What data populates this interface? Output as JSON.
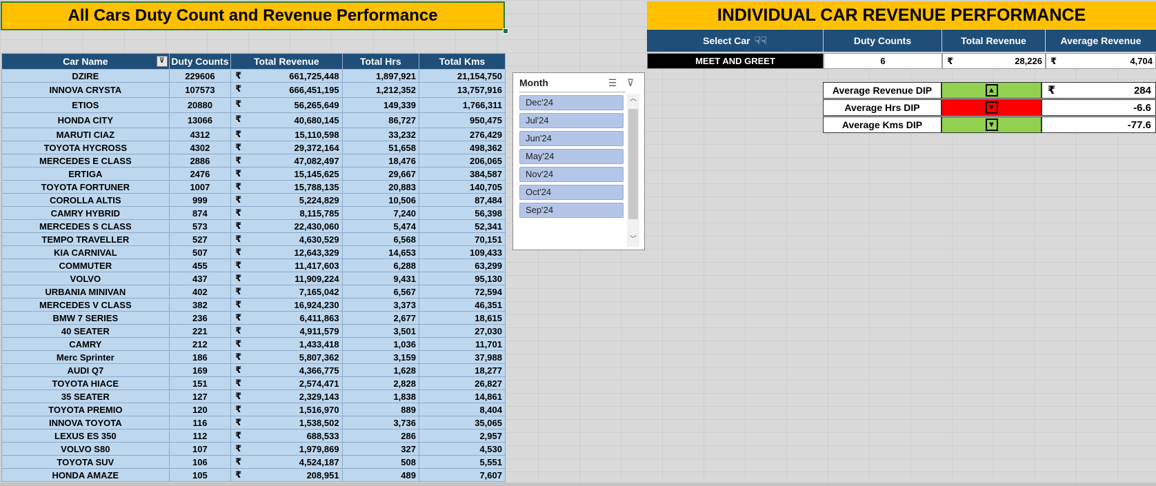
{
  "left_title": "All Cars Duty Count and Revenue Performance",
  "table": {
    "currency_symbol": "₹",
    "headers": [
      "Car Name",
      "Duty Counts",
      "Total Revenue",
      "Total Hrs",
      "Total Kms"
    ],
    "rows": [
      {
        "name": "DZIRE",
        "duty": "229606",
        "rev": "661,725,448",
        "hrs": "1,897,921",
        "kms": "21,154,750"
      },
      {
        "name": "INNOVA CRYSTA",
        "duty": "107573",
        "rev": "666,451,195",
        "hrs": "1,212,352",
        "kms": "13,757,916"
      },
      {
        "name": "ETIOS",
        "duty": "20880",
        "rev": "56,265,649",
        "hrs": "149,339",
        "kms": "1,766,311"
      },
      {
        "name": "HONDA CITY",
        "duty": "13066",
        "rev": "40,680,145",
        "hrs": "86,727",
        "kms": "950,475"
      },
      {
        "name": "MARUTI CIAZ",
        "duty": "4312",
        "rev": "15,110,598",
        "hrs": "33,232",
        "kms": "276,429"
      },
      {
        "name": "TOYOTA HYCROSS",
        "duty": "4302",
        "rev": "29,372,164",
        "hrs": "51,658",
        "kms": "498,362"
      },
      {
        "name": "MERCEDES E CLASS",
        "duty": "2886",
        "rev": "47,082,497",
        "hrs": "18,476",
        "kms": "206,065"
      },
      {
        "name": "ERTIGA",
        "duty": "2476",
        "rev": "15,145,625",
        "hrs": "29,667",
        "kms": "384,587"
      },
      {
        "name": "TOYOTA FORTUNER",
        "duty": "1007",
        "rev": "15,788,135",
        "hrs": "20,883",
        "kms": "140,705"
      },
      {
        "name": "COROLLA ALTIS",
        "duty": "999",
        "rev": "5,224,829",
        "hrs": "10,506",
        "kms": "87,484"
      },
      {
        "name": "CAMRY HYBRID",
        "duty": "874",
        "rev": "8,115,785",
        "hrs": "7,240",
        "kms": "56,398"
      },
      {
        "name": "MERCEDES S CLASS",
        "duty": "573",
        "rev": "22,430,060",
        "hrs": "5,474",
        "kms": "52,341"
      },
      {
        "name": "TEMPO TRAVELLER",
        "duty": "527",
        "rev": "4,630,529",
        "hrs": "6,568",
        "kms": "70,151"
      },
      {
        "name": "KIA CARNIVAL",
        "duty": "507",
        "rev": "12,643,329",
        "hrs": "14,653",
        "kms": "109,433"
      },
      {
        "name": "COMMUTER",
        "duty": "455",
        "rev": "11,417,603",
        "hrs": "6,288",
        "kms": "63,299"
      },
      {
        "name": "VOLVO",
        "duty": "437",
        "rev": "11,909,224",
        "hrs": "9,431",
        "kms": "95,130"
      },
      {
        "name": "URBANIA MINIVAN",
        "duty": "402",
        "rev": "7,165,042",
        "hrs": "6,567",
        "kms": "72,594"
      },
      {
        "name": "MERCEDES V CLASS",
        "duty": "382",
        "rev": "16,924,230",
        "hrs": "3,373",
        "kms": "46,351"
      },
      {
        "name": "BMW 7 SERIES",
        "duty": "236",
        "rev": "6,411,863",
        "hrs": "2,677",
        "kms": "18,615"
      },
      {
        "name": "40 SEATER",
        "duty": "221",
        "rev": "4,911,579",
        "hrs": "3,501",
        "kms": "27,030"
      },
      {
        "name": "CAMRY",
        "duty": "212",
        "rev": "1,433,418",
        "hrs": "1,036",
        "kms": "11,701"
      },
      {
        "name": "Merc Sprinter",
        "duty": "186",
        "rev": "5,807,362",
        "hrs": "3,159",
        "kms": "37,988"
      },
      {
        "name": "AUDI Q7",
        "duty": "169",
        "rev": "4,366,775",
        "hrs": "1,628",
        "kms": "18,277"
      },
      {
        "name": "TOYOTA HIACE",
        "duty": "151",
        "rev": "2,574,471",
        "hrs": "2,828",
        "kms": "26,827"
      },
      {
        "name": "35 SEATER",
        "duty": "127",
        "rev": "2,329,143",
        "hrs": "1,838",
        "kms": "14,861"
      },
      {
        "name": "TOYOTA PREMIO",
        "duty": "120",
        "rev": "1,516,970",
        "hrs": "889",
        "kms": "8,404"
      },
      {
        "name": "INNOVA TOYOTA",
        "duty": "116",
        "rev": "1,538,502",
        "hrs": "3,736",
        "kms": "35,065"
      },
      {
        "name": "LEXUS ES 350",
        "duty": "112",
        "rev": "688,533",
        "hrs": "286",
        "kms": "2,957"
      },
      {
        "name": "VOLVO S80",
        "duty": "107",
        "rev": "1,979,869",
        "hrs": "327",
        "kms": "4,530"
      },
      {
        "name": "TOYOTA SUV",
        "duty": "106",
        "rev": "4,524,187",
        "hrs": "508",
        "kms": "5,551"
      },
      {
        "name": "HONDA AMAZE",
        "duty": "105",
        "rev": "208,951",
        "hrs": "489",
        "kms": "7,607"
      }
    ]
  },
  "slicer": {
    "title": "Month",
    "items": [
      "Dec'24",
      "Jul'24",
      "Jun'24",
      "May'24",
      "Nov'24",
      "Oct'24",
      "Sep'24"
    ]
  },
  "right_panel": {
    "title": "INDIVIDUAL CAR REVENUE PERFORMANCE",
    "select_label": "Select Car",
    "headers": [
      "Duty Counts",
      "Total Revenue",
      "Average Revenue"
    ],
    "selected_car": "MEET AND GREET",
    "duty_counts": "6",
    "total_revenue": "28,226",
    "average_revenue": "4,704",
    "dips": [
      {
        "label": "Average Revenue DIP",
        "value": "284",
        "status": "up",
        "color": "#92d050",
        "show_currency": true
      },
      {
        "label": "Average Hrs DIP",
        "value": "-6.6",
        "status": "down",
        "color": "#ff0000",
        "show_currency": false
      },
      {
        "label": "Average Kms DIP",
        "value": "-77.6",
        "status": "down",
        "color": "#92d050",
        "show_currency": false
      }
    ]
  }
}
